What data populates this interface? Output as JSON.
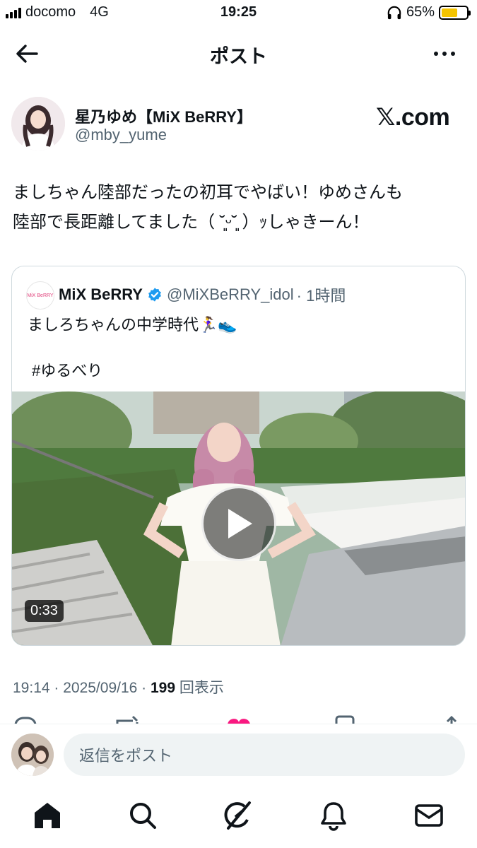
{
  "status_bar": {
    "carrier": "docomo",
    "network": "4G",
    "time": "19:25",
    "battery": "65%",
    "battery_level": 0.65
  },
  "header": {
    "title": "ポスト"
  },
  "post": {
    "author_name": "星乃ゆめ【MiX BeRRY】",
    "author_handle": "@mby_yume",
    "watermark": "𝕏.com",
    "text_line1": "ましちゃん陸部だったの初耳でやばい！ゆめさんも",
    "text_line2": "陸部で長距離してました（ ˘͈ᵕ˘͈ ）ｯしゃきーん！",
    "timestamp": "19:14 · 2025/09/16 · ",
    "views_count": "199",
    "views_label": " 回表示"
  },
  "quote": {
    "avatar_text": "MiX BeRRY",
    "name": "MiX BeRRY",
    "handle": "@MiXBeRRY_idol",
    "time": "· 1時間",
    "text": "ましろちゃんの中学時代🏃‍♀️👟",
    "hashtag": "#ゆるべり",
    "video_duration": "0:33"
  },
  "reply": {
    "placeholder": "返信をポスト"
  },
  "tabs": [
    "home",
    "search",
    "grok",
    "notifications",
    "messages"
  ],
  "colors": {
    "accent": "#1d9bf0",
    "like": "#f91880",
    "battery": "#f5c400"
  }
}
